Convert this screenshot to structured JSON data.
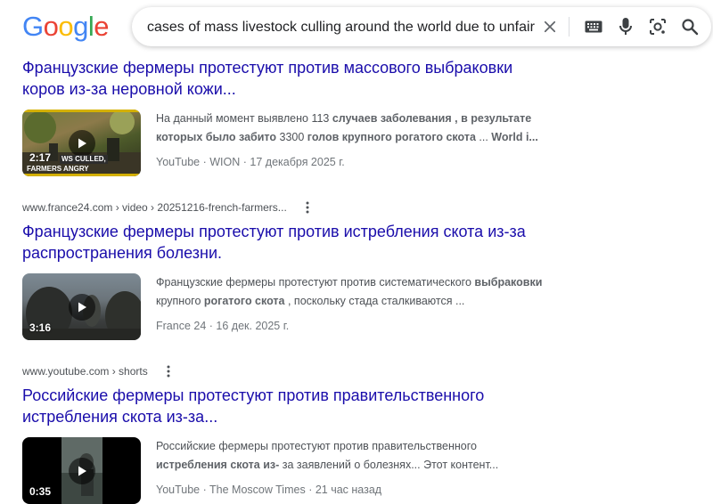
{
  "logo": {
    "letters": [
      "G",
      "o",
      "o",
      "g",
      "l",
      "e"
    ],
    "colors": [
      "#4285F4",
      "#EA4335",
      "#FBBC05",
      "#4285F4",
      "#34A853",
      "#EA4335"
    ]
  },
  "search": {
    "query": "cases of mass livestock culling around the world due to unfair compe",
    "icons": [
      "close-icon",
      "keyboard-icon",
      "microphone-icon",
      "lens-icon",
      "search-icon"
    ]
  },
  "results": [
    {
      "cite": "",
      "title": "Французские фермеры протестуют против массового выбраковки коров из-за неровной кожи...",
      "duration": "2:17",
      "thumb_caption_1": "WS CULLED,",
      "thumb_caption_2": "FARMERS ANGRY",
      "snippet": [
        {
          "t": "На данный момент выявлено 113 ",
          "b": false
        },
        {
          "t": "случаев заболевания",
          "b": true
        },
        {
          "t": " , ",
          "b": false
        },
        {
          "t": "в результате которых было забито",
          "b": true
        },
        {
          "t": " 3300 ",
          "b": false
        },
        {
          "t": "голов крупного рогатого скота",
          "b": true
        },
        {
          "t": " ... ",
          "b": false
        },
        {
          "t": "World i...",
          "b": true
        }
      ],
      "source": "YouTube",
      "author": "WION",
      "date": "17 декабря 2025 г."
    },
    {
      "cite": "www.france24.com › video › 20251216-french-farmers...",
      "title": "Французские фермеры протестуют против истребления скота из-за распространения болезни.",
      "duration": "3:16",
      "snippet": [
        {
          "t": "Французские фермеры протестуют против систематического ",
          "b": false
        },
        {
          "t": "выбраковки",
          "b": true
        },
        {
          "t": " крупного ",
          "b": false
        },
        {
          "t": "рогатого скота",
          "b": true
        },
        {
          "t": " , поскольку стада сталкиваются ...",
          "b": false
        }
      ],
      "source": "France 24",
      "author": "",
      "date": "16 дек. 2025 г."
    },
    {
      "cite": "www.youtube.com › shorts",
      "title": "Российские фермеры протестуют против правительственного истребления скота из-за...",
      "duration": "0:35",
      "snippet": [
        {
          "t": "Российские фермеры протестуют против правительственного ",
          "b": false
        },
        {
          "t": "истребления скота из-",
          "b": true
        },
        {
          "t": " за заявлений о болезнях... Этот контент...",
          "b": false
        }
      ],
      "source": "YouTube",
      "author": "The Moscow Times",
      "date": "21 час назад"
    }
  ]
}
